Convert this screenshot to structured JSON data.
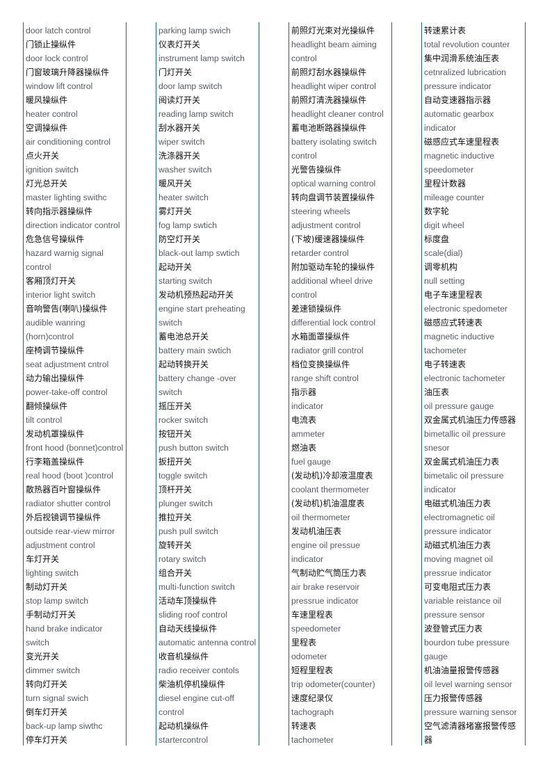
{
  "columns": [
    [
      "door latch control",
      "门锁止操纵件",
      "door lock control",
      "门窗玻璃升降器操纵件",
      "window lift control",
      "暖风操纵件",
      "heater control",
      "空调操纵件",
      "air conditioning control",
      "点火开关",
      "ignition switch",
      "灯光总开关",
      "master lighting swithc",
      "转向指示器操纵件",
      "direction indicator control",
      "危急信号操纵件",
      "hazard warnig signal",
      "control",
      "客厢顶灯开关",
      "interior light switch",
      "音响警告(喇叭)操纵件",
      "audible wanring",
      "(horn)control",
      "座椅调节操纵件",
      "seat adjustment cntrol",
      "动力输出操纵件",
      "power-take-off control",
      "翻倾操纵件",
      "tilt control",
      "发动机罩操纵件",
      "front hood (bonnet)control",
      "行李箱盖操纵件",
      "real hood (boot )control",
      "散热器百叶窗操纵件",
      "radiator shutter control",
      "外后视镜调节操纵件",
      "outside rear-view mirror",
      "adjustment control",
      "车灯开关",
      "lighting switch",
      "制动灯开关",
      "stop lamp switch",
      "手制动灯开关",
      "hand brake indicator",
      "switch",
      "变光开关",
      "dimmer switch",
      "转向灯开关",
      "turn signal swich",
      "倒车灯开关",
      "back-up lamp siwthc",
      "停车灯开关"
    ],
    [
      "parking lamp swich",
      "仪表灯开关",
      "instrument lamp switch",
      "门灯开关",
      "door lamp switch",
      "阅读灯开关",
      "reading lamp switch",
      "刮水器开关",
      "wiper switch",
      "洗涤器开关",
      "washer switch",
      "暖风开关",
      "heater switch",
      "雾灯开关",
      "fog lamp swtich",
      "防空灯开关",
      "black-out lamp swtich",
      "起动开关",
      "starting switch",
      "发动机预热起动开关",
      "engine start preheating",
      "switch",
      "蓄电池总开关",
      "battery main swtich",
      "起动转换开关",
      "battery change -over",
      "switch",
      "摇压开关",
      "rocker switch",
      "按钮开关",
      "push button switch",
      "扳扭开关",
      "toggle switch",
      "顶杆开关",
      "plunger switch",
      "推拉开关",
      "push pull switch",
      "旋转开关",
      "rotary switch",
      "组合开关",
      "multi-function switch",
      "活动车顶操纵件",
      "sliding roof control",
      "自动天线操纵件",
      "automatic antenna control",
      "收音机操纵件",
      "radio receiver contols",
      "柴油机停机操纵件",
      "diesel engine cut-off",
      "control",
      "起动机操纵件",
      "startercontrol"
    ],
    [
      "前照灯光束对光操纵件",
      "headlight beam aiming",
      "control",
      "前照灯刮水器操纵件",
      "headlight wiper control",
      "前照灯清洗器操纵件",
      "headlight cleaner control",
      "蓄电池断路器操纵件",
      "battery isolating switch",
      "control",
      "光警告操纵件",
      "optical warning control",
      "转向盘调节装置操纵件",
      "steering wheels",
      "adjustment control",
      "(下坡)缓速器操纵件",
      "retarder control",
      "附加驱动车轮的操纵件",
      "additional wheel drive",
      "control",
      "差速锁操纵件",
      "differential lock control",
      "水箱面罩操纵件",
      "radiator grill control",
      "档位变换操纵件",
      "range shift control",
      "指示器",
      "indicator",
      "电流表",
      "ammeter",
      "燃油表",
      "fuel gauge",
      "(发动机)冷却液温度表",
      "coolant thermometer",
      "(发动机)机油温度表",
      "oil thermometer",
      "发动机油压表",
      "engine oil pressue",
      "indicator",
      "气制动贮气筒压力表",
      "air brake reservoir",
      "pressrue indicator",
      "车速里程表",
      "speedometer",
      "里程表",
      "odometer",
      "短程里程表",
      "trip odometer(counter)",
      "速度纪录仪",
      "tachograph",
      "转速表",
      "tachometer"
    ],
    [
      "转速累计表",
      "total revolution counter",
      "集中润滑系统油压表",
      "cetnralized lubrication",
      "pressure indicator",
      "自动变速器指示器",
      "automatic gearbox",
      "indicator",
      "磁感应式车速里程表",
      "magnetic inductive",
      "speedometer",
      "里程计数器",
      "mileage counter",
      "数字轮",
      "digit wheel",
      "标度盘",
      "scale(dial)",
      "调零机构",
      "null setting",
      "电子车速里程表",
      "electronic spedometer",
      "磁感应式转速表",
      "magnetic inductive",
      "tachometer",
      "电子转速表",
      "electronic tachometer",
      "油压表",
      "oil pressure gauge",
      "双金属式机油压力传感器",
      "bimetallic oil pressure",
      "snesor",
      "双金属式机油压力表",
      "bimetalic oil pressure",
      "indicator",
      "电磁式机油压力表",
      "electromagnetic oil",
      "pressure indicator",
      "动磁式机油压力表",
      "moving magnet oil",
      "pressrue indicator",
      "可变电阻式压力表",
      "variable reistance oil",
      "pressure sensor",
      "波登管式压力表",
      "bourdon tube pressure",
      "gauge",
      "机油油量报警传感器",
      "oil level warning sensor",
      "压力报警传感器",
      "pressure warning sensor",
      "空气滤清器堵塞报警传感",
      "器"
    ]
  ],
  "colors": {
    "rule": "#1f5f99",
    "english_text": "#555a66",
    "chinese_text": "#111111"
  }
}
